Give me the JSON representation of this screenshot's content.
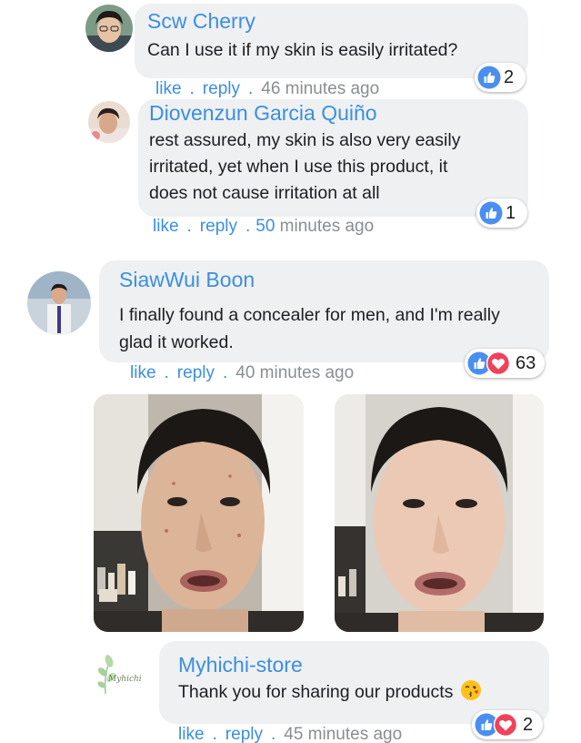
{
  "comments": [
    {
      "author": "Scw Cherry",
      "text": "Can I use it if my skin is easily irritated?",
      "like_label": "like",
      "reply_label": "reply",
      "time": "46 minutes ago",
      "reaction_count": "2"
    },
    {
      "author": "Diovenzun Garcia Quiño",
      "text_lines": [
        "rest assured, my skin is also very easily",
        "irritated, yet when I use this product, it",
        "does not cause irritation at all"
      ],
      "like_label": "like",
      "reply_label": "reply",
      "time_num": "50",
      "time_rest": " minutes ago",
      "reaction_count": "1"
    },
    {
      "author": "SiawWui Boon",
      "text_lines": [
        "I finally found a concealer for men, and I'm really",
        "glad it worked."
      ],
      "like_label": "like",
      "reply_label": "reply",
      "time": "40 minutes ago",
      "reaction_count": "63"
    },
    {
      "author": "Myhichi-store",
      "text": "Thank you for sharing our products",
      "like_label": "like",
      "reply_label": "reply",
      "time": "45 minutes ago",
      "reaction_count": "2",
      "avatar_logo_text": "Myhichi"
    }
  ],
  "colors": {
    "link": "#3a8fe0",
    "bubble": "#eff0f2",
    "like_blue": "#4a8ff0",
    "love_red": "#f0425a",
    "meta_gray": "#8a8d91"
  },
  "icons": [
    "like-icon",
    "love-icon",
    "blow-kiss-emoji"
  ]
}
